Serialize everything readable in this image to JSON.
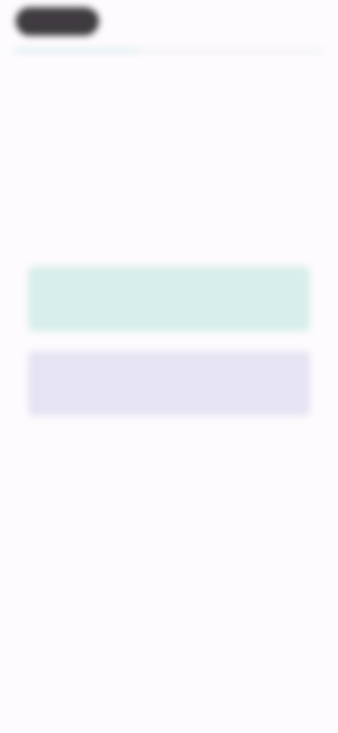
{
  "header": {
    "back_label": "",
    "progress_fraction": 0.4
  },
  "prompt": {
    "question": "",
    "description": ""
  },
  "answers": {
    "yes_label": "",
    "no_label": ""
  },
  "colors": {
    "background": "#fdfbfd",
    "pill": "#3f3b40",
    "yes_button": "#d7eeea",
    "no_button": "#e6e3f3",
    "progress_fill": "#cfe7ee"
  }
}
